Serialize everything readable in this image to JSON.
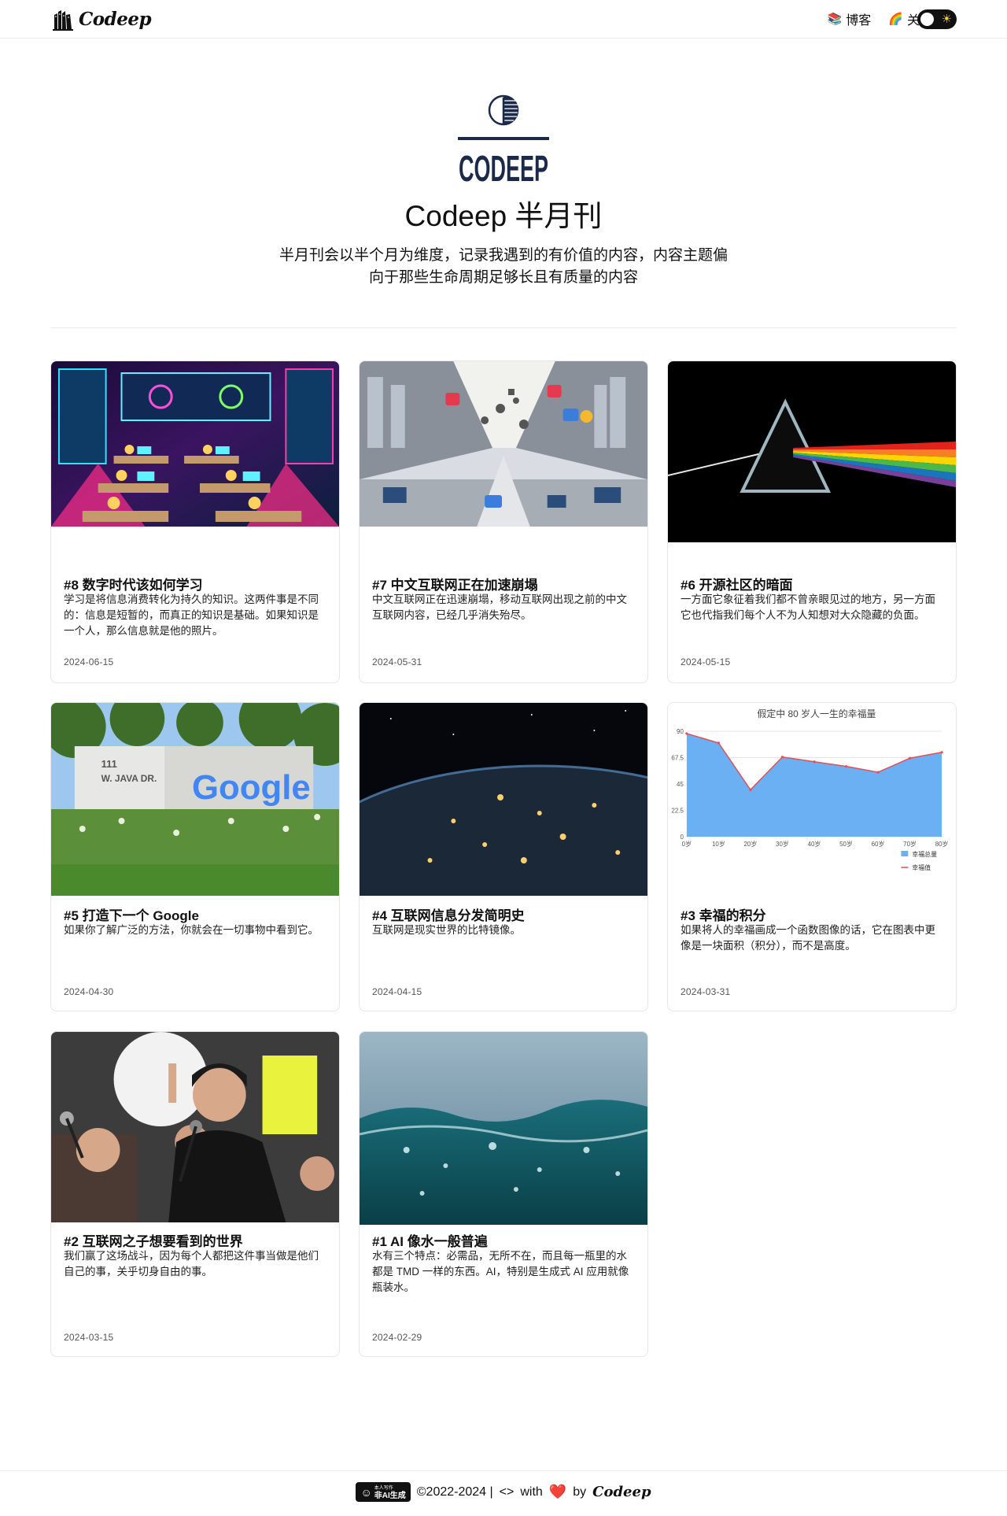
{
  "header": {
    "logo_text": "Codeep",
    "nav": [
      {
        "emoji": "📚",
        "label": "博客"
      },
      {
        "emoji": "🌈",
        "label": "关于"
      }
    ],
    "theme_toggle_icon": "☀"
  },
  "hero": {
    "logo_word": "CODEEP",
    "title": "Codeep 半月刊",
    "description": "半月刊会以半个月为维度，记录我遇到的有价值的内容，内容主题偏向于那些生命周期足够长且有质量的内容"
  },
  "cards": [
    {
      "title": "#8 数字时代该如何学习",
      "summary": "学习是将信息消费转化为持久的知识。这两件事是不同的：信息是短暂的，而真正的知识是基础。如果知识是一个人，那么信息就是他的照片。",
      "date": "2024-06-15",
      "image": "digital-classroom-illustration"
    },
    {
      "title": "#7 中文互联网正在加速崩塌",
      "summary": "中文互联网正在迅速崩塌，移动互联网出现之前的中文互联网内容，已经几乎消失殆尽。",
      "date": "2024-05-31",
      "image": "collapsing-internet-illustration"
    },
    {
      "title": "#6 开源社区的暗面",
      "summary": "一方面它象征着我们都不曾亲眼见过的地方，另一方面它也代指我们每个人不为人知想对大众隐藏的负面。",
      "date": "2024-05-15",
      "image": "prism-rainbow"
    },
    {
      "title": "#5 打造下一个 Google",
      "summary": "如果你了解广泛的方法，你就会在一切事物中看到它。",
      "date": "2024-04-30",
      "image": "google-sign-photo",
      "sign_address_1": "111",
      "sign_address_2": "W. JAVA DR.",
      "sign_brand": "Google"
    },
    {
      "title": "#4 互联网信息分发简明史",
      "summary": "互联网是现实世界的比特镜像。",
      "date": "2024-04-15",
      "image": "earth-night-lights"
    },
    {
      "title": "#3 幸福的积分",
      "summary": "如果将人的幸福画成一个函数图像的话，它在图表中更像是一块面积（积分），而不是高度。",
      "date": "2024-03-31",
      "image": "happiness-area-chart"
    },
    {
      "title": "#2 互联网之子想要看到的世界",
      "summary": "我们赢了这场战斗，因为每个人都把这件事当做是他们自己的事，关乎切身自由的事。",
      "date": "2024-03-15",
      "image": "speaker-protest-photo"
    },
    {
      "title": "#1 AI 像水一般普遍",
      "summary": "水有三个特点：必需品，无所不在，而且每一瓶里的水都是 TMD 一样的东西。AI，特别是生成式 AI 应用就像瓶装水。",
      "date": "2024-02-29",
      "image": "water-surface-photo"
    }
  ],
  "chart_data": {
    "type": "area",
    "title": "假定中 80 岁人一生的幸福量",
    "x": [
      "0岁",
      "10岁",
      "20岁",
      "30岁",
      "40岁",
      "50岁",
      "60岁",
      "70岁",
      "80岁"
    ],
    "series": [
      {
        "name": "幸福总量",
        "values": [
          88,
          80,
          40,
          68,
          64,
          60,
          55,
          67,
          72
        ]
      },
      {
        "name": "幸福值",
        "values": [
          88,
          80,
          40,
          68,
          64,
          60,
          55,
          67,
          72
        ]
      }
    ],
    "yticks": [
      "0",
      "22.5",
      "45",
      "67.5",
      "90"
    ],
    "ylim": [
      0,
      90
    ],
    "legend_position": "bottom-right",
    "colors": {
      "area": "#6ab0f3",
      "line": "#e0505a"
    }
  },
  "footer": {
    "badge_small": "本人写作",
    "badge_big": "非AI生成",
    "copyright": "©2022-2024 |",
    "code_icon": "<>",
    "with": "with",
    "heart": "❤️",
    "by": "by",
    "logo_text": "Codeep"
  }
}
